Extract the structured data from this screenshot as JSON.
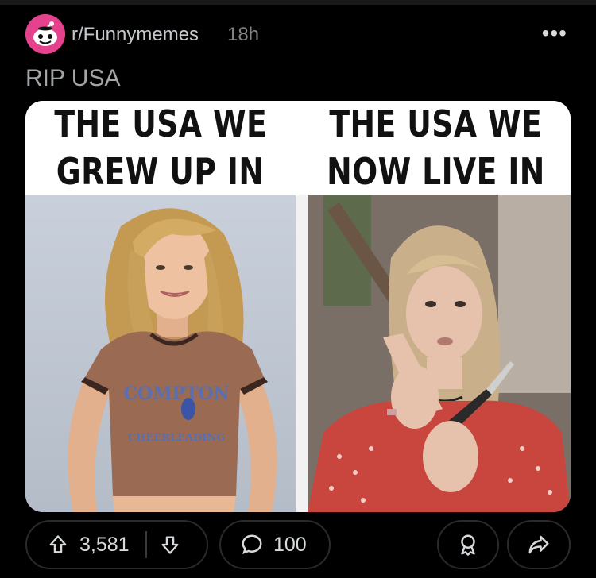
{
  "post": {
    "subreddit": "r/Funnymemes",
    "age": "18h",
    "title": "RIP USA",
    "more_label": "•••"
  },
  "image": {
    "caption_left_line1": "THE USA WE",
    "caption_left_line2": "GREW UP IN",
    "caption_right_line1": "THE USA WE",
    "caption_right_line2": "NOW LIVE IN",
    "shirt_text_top": "COMPTON",
    "shirt_text_bottom": "CHEERLEADING"
  },
  "actions": {
    "upvotes": "3,581",
    "comments": "100"
  },
  "colors": {
    "background": "#000000",
    "subreddit_avatar": "#e4428c",
    "muted_text": "#818384",
    "border": "#2a2a2c"
  },
  "icons": [
    "snoo-avatar-icon",
    "more-icon",
    "upvote-icon",
    "downvote-icon",
    "comment-icon",
    "award-icon",
    "share-icon"
  ]
}
